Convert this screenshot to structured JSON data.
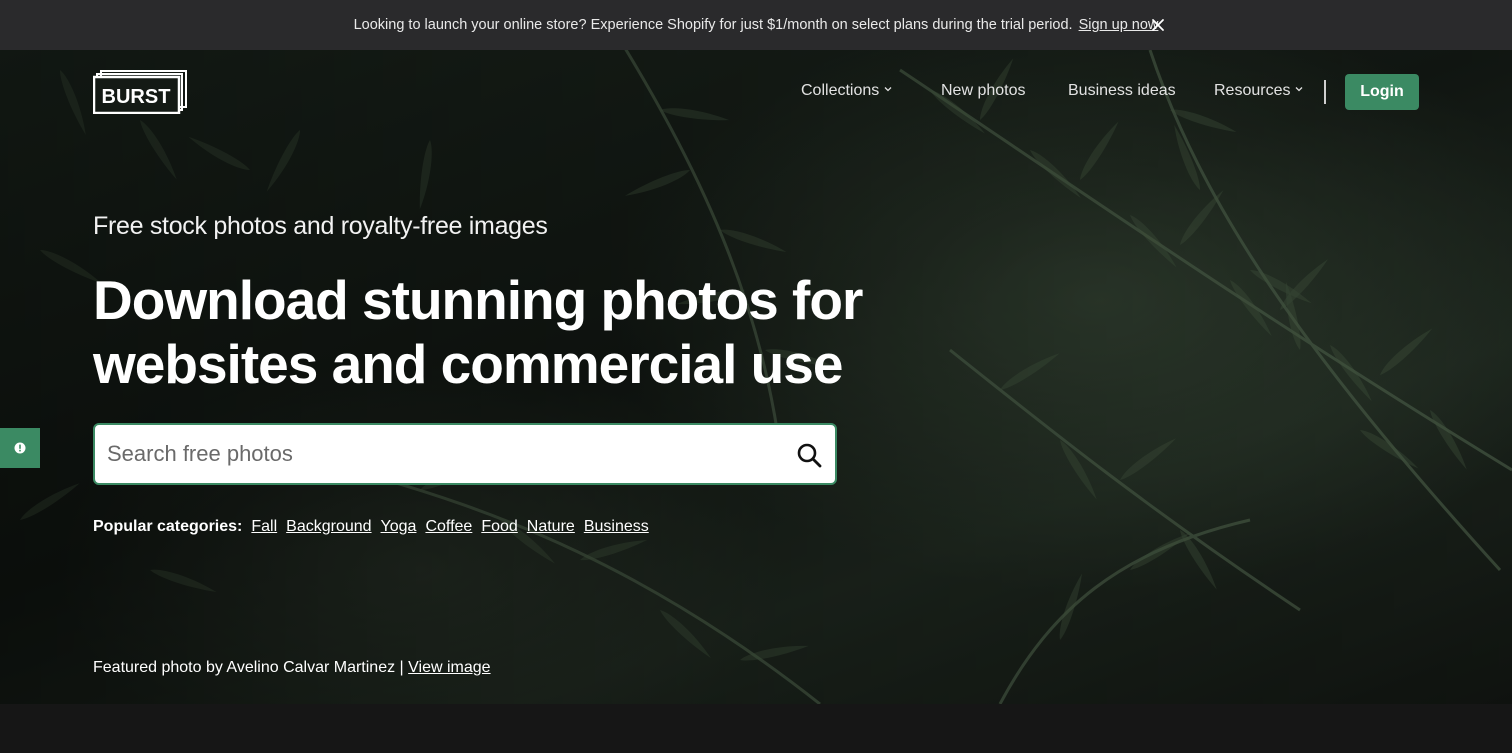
{
  "announcement": {
    "message": "Looking to launch your online store? Experience Shopify for just $1/month on select plans during the trial period.",
    "link": "Sign up now",
    "close_icon": "close-icon"
  },
  "header": {
    "logo_text": "BURST",
    "nav": [
      {
        "label": "Collections",
        "has_dropdown": true
      },
      {
        "label": "New photos",
        "has_dropdown": false
      },
      {
        "label": "Business ideas",
        "has_dropdown": false
      },
      {
        "label": "Resources",
        "has_dropdown": true
      }
    ],
    "login_label": "Login"
  },
  "hero": {
    "subtitle": "Free stock photos and royalty-free images",
    "headline": "Download stunning photos for websites and commercial use",
    "search": {
      "placeholder": "Search free photos",
      "value": ""
    },
    "categories_label": "Popular categories:",
    "categories": [
      "Fall",
      "Background",
      "Yoga",
      "Coffee",
      "Food",
      "Nature",
      "Business"
    ],
    "credit_text": "Featured photo by Avelino Calvar Martinez |",
    "credit_link": "View image"
  },
  "colors": {
    "accent": "#3b8a63",
    "announcement_bg": "#2a2a2c",
    "hero_dark": "#141a15"
  }
}
